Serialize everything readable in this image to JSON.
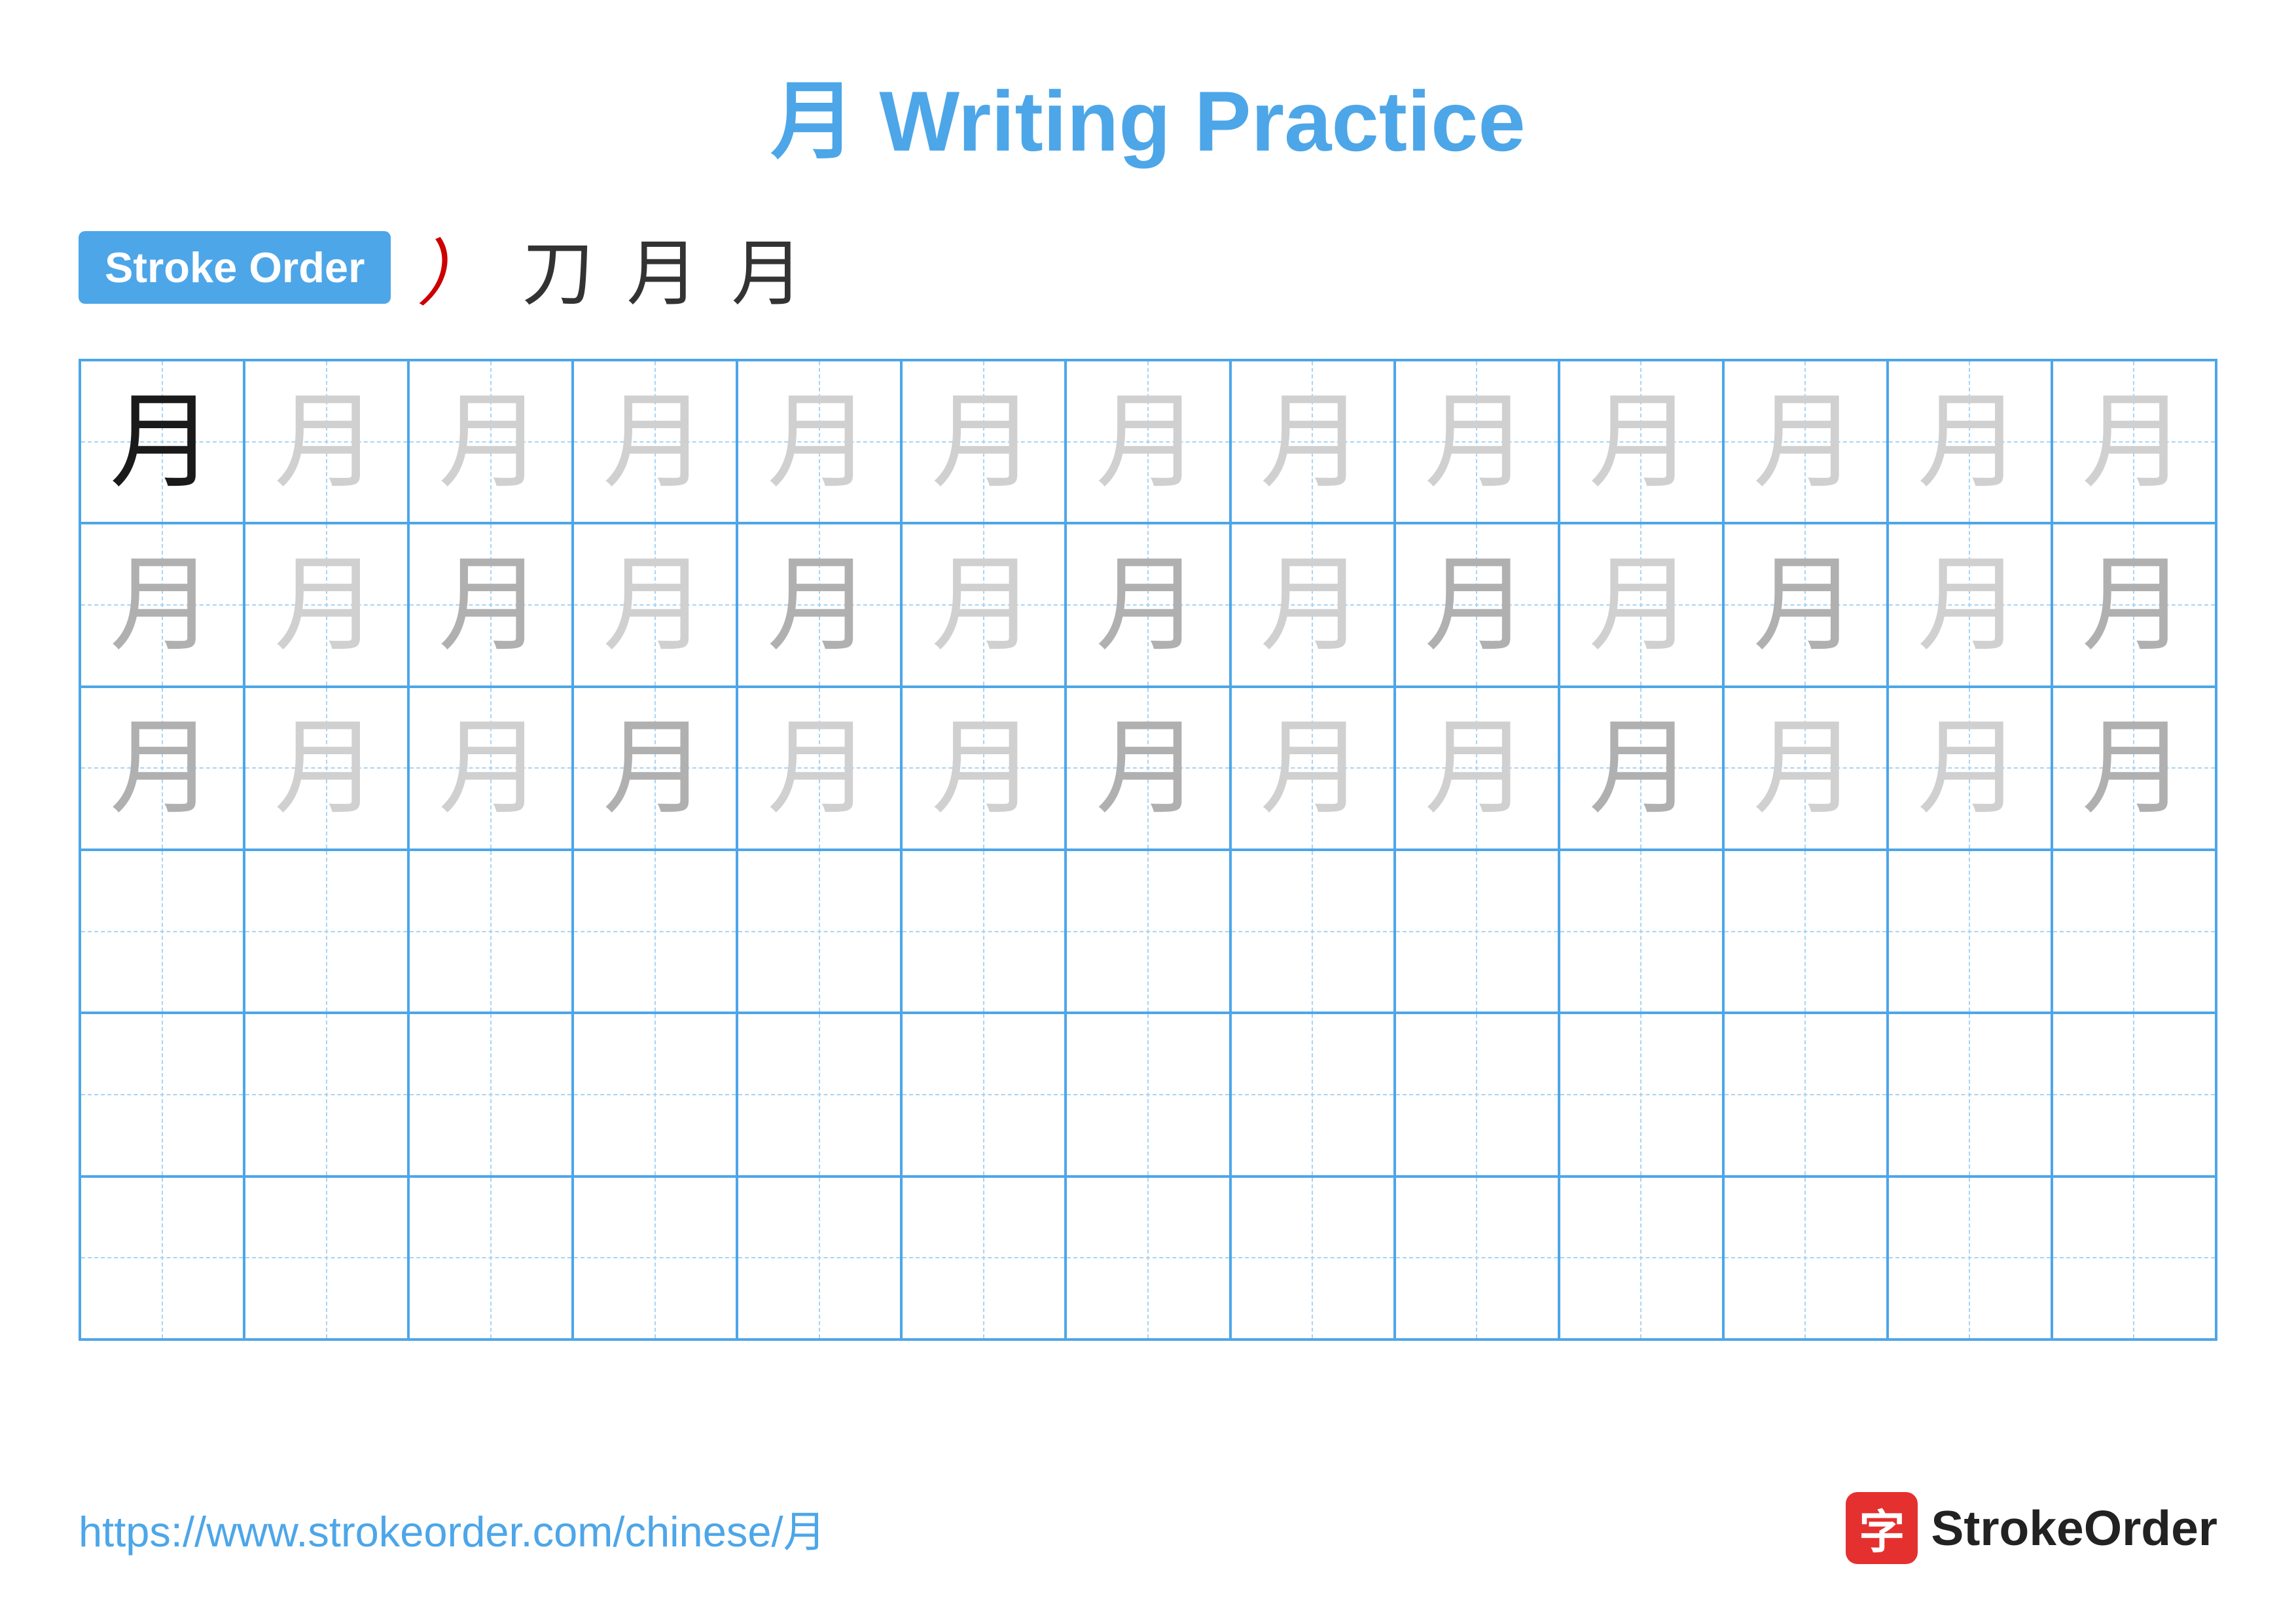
{
  "title": "月 Writing Practice",
  "stroke_order": {
    "badge_label": "Stroke Order",
    "steps": [
      "）",
      "刀",
      "月",
      "月"
    ]
  },
  "grid": {
    "rows": 6,
    "cols": 13,
    "character": "月",
    "row_types": [
      "dark_first_light_rest",
      "light_all",
      "light_all",
      "empty",
      "empty",
      "empty"
    ]
  },
  "footer": {
    "url": "https://www.strokeorder.com/chinese/月",
    "logo_icon": "字",
    "logo_text": "StrokeOrder"
  }
}
